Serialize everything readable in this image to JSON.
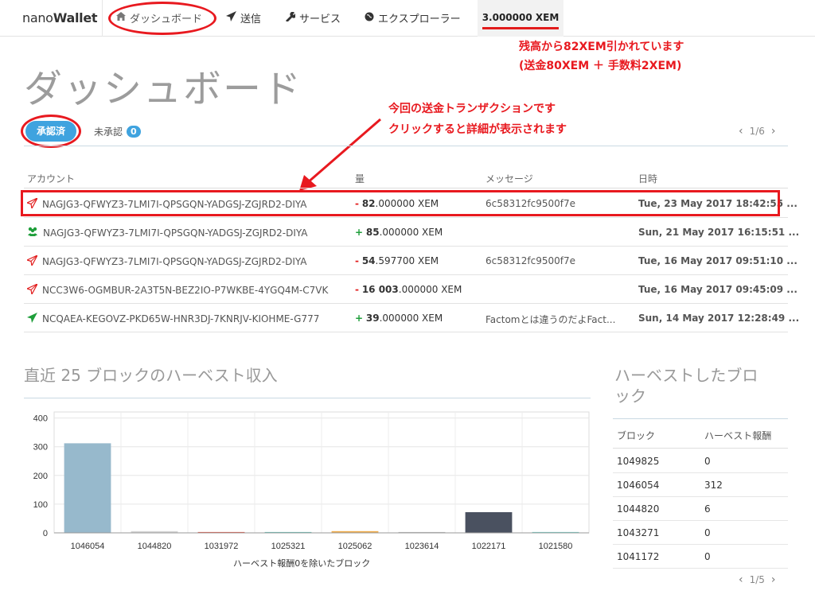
{
  "nav": {
    "brand_light": "nano",
    "brand_bold": "Wallet",
    "dashboard": "ダッシュボード",
    "send": "送信",
    "services": "サービス",
    "explorer": "エクスプローラー",
    "balance": "3.000000 XEM"
  },
  "annotations": {
    "balance_note_1": "残高から82XEM引かれています",
    "balance_note_2": "(送金80XEM ＋ 手数料2XEM)",
    "tx_note_1": "今回の送金トランザクションです",
    "tx_note_2": "クリックすると詳細が表示されます"
  },
  "page_title": "ダッシュボード",
  "tabs": {
    "confirmed": "承認済",
    "unconfirmed": "未承認",
    "unconfirmed_count": "0",
    "pager": "1/6"
  },
  "tx_table": {
    "headers": {
      "account": "アカウント",
      "amount": "量",
      "message": "メッセージ",
      "date": "日時"
    },
    "rows": [
      {
        "icon": "send-icon",
        "account": "NAGJG3-QFWYZ3-7LMI7I-QPSGQN-YADGSJ-ZGJRD2-DIYA",
        "sign": "-",
        "int": "82",
        "dec": ".000000",
        "unit": "XEM",
        "message": "6c58312fc9500f7e",
        "date": "Tue, 23 May 2017 18:42:55 ..."
      },
      {
        "icon": "multisig-icon",
        "account": "NAGJG3-QFWYZ3-7LMI7I-QPSGQN-YADGSJ-ZGJRD2-DIYA",
        "sign": "+",
        "int": "85",
        "dec": ".000000",
        "unit": "XEM",
        "message": "",
        "date": "Sun, 21 May 2017 16:15:51 ..."
      },
      {
        "icon": "send-icon",
        "account": "NAGJG3-QFWYZ3-7LMI7I-QPSGQN-YADGSJ-ZGJRD2-DIYA",
        "sign": "-",
        "int": "54",
        "dec": ".597700",
        "unit": "XEM",
        "message": "6c58312fc9500f7e",
        "date": "Tue, 16 May 2017 09:51:10 ..."
      },
      {
        "icon": "send-icon",
        "account": "NCC3W6-OGMBUR-2A3T5N-BEZ2IO-P7WKBE-4YGQ4M-C7VK",
        "sign": "-",
        "int": "16 003",
        "dec": ".000000",
        "unit": "XEM",
        "message": "",
        "date": "Tue, 16 May 2017 09:45:09 ..."
      },
      {
        "icon": "receive-icon",
        "account": "NCQAEA-KEGOVZ-PKD65W-HNR3DJ-7KNRJV-KIOHME-G777",
        "sign": "+",
        "int": "39",
        "dec": ".000000",
        "unit": "XEM",
        "message": "Factomとは違うのだよFact...",
        "date": "Sun, 14 May 2017 12:28:49 ..."
      }
    ]
  },
  "harvest_chart_title": "直近 25 ブロックのハーベスト収入",
  "harvest_table_title_1": "ハーベストしたブロ",
  "harvest_table_title_2": "ック",
  "harvest_table": {
    "headers": {
      "block": "ブロック",
      "reward": "ハーベスト報酬"
    },
    "rows": [
      {
        "block": "1049825",
        "reward": "0"
      },
      {
        "block": "1046054",
        "reward": "312"
      },
      {
        "block": "1044820",
        "reward": "6"
      },
      {
        "block": "1043271",
        "reward": "0"
      },
      {
        "block": "1041172",
        "reward": "0"
      }
    ],
    "pager": "1/5"
  },
  "colors": {
    "accent": "#3fa3df",
    "annotation": "#e8191f",
    "negative": "#e21b1b",
    "positive": "#1e9e3a"
  },
  "chart_data": {
    "type": "bar",
    "categories": [
      "1046054",
      "1044820",
      "1031972",
      "1025321",
      "1025062",
      "1023614",
      "1022171",
      "1021580"
    ],
    "values": [
      312,
      6,
      3,
      3,
      6,
      3,
      72,
      3
    ],
    "colors": [
      "#97b9cc",
      "#d5d5d5",
      "#e74c3c",
      "#5fc1b6",
      "#f0ad4e",
      "#bcbcbc",
      "#4a5160",
      "#6fd0c6"
    ],
    "xlabel": "ハーベスト報酬0を除いたブロック",
    "ylabel": "",
    "yticks": [
      0,
      100,
      200,
      300,
      400
    ],
    "ylim": [
      0,
      410
    ]
  }
}
